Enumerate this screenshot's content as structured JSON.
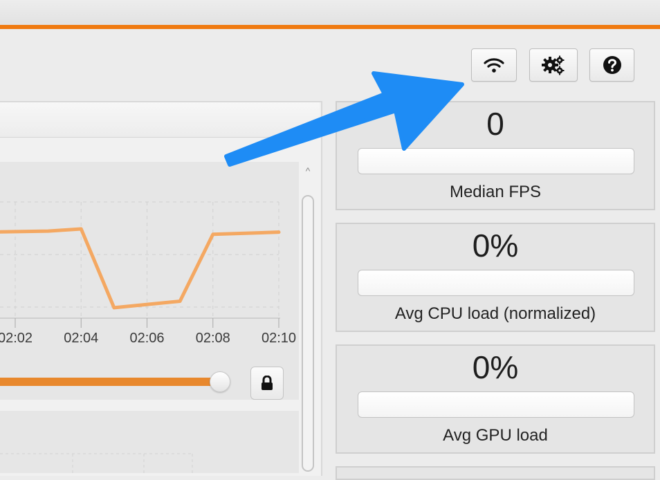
{
  "colors": {
    "accent": "#f07a10",
    "series": "#f4a862",
    "arrow": "#1e8cf5"
  },
  "toolbar": {
    "buttons": [
      {
        "icon": "wifi-icon"
      },
      {
        "icon": "gear-icon"
      },
      {
        "icon": "help-icon"
      }
    ]
  },
  "timeline": {
    "ticks": [
      "02:02",
      "02:04",
      "02:06",
      "02:08",
      "02:10"
    ],
    "series": [
      {
        "t": "02:01",
        "v": 0.72
      },
      {
        "t": "02:03",
        "v": 0.73
      },
      {
        "t": "02:04",
        "v": 0.75
      },
      {
        "t": "02:05",
        "v": 0.02
      },
      {
        "t": "02:07",
        "v": 0.08
      },
      {
        "t": "02:08",
        "v": 0.7
      },
      {
        "t": "02:10",
        "v": 0.72
      }
    ],
    "slider_position": 1.0,
    "lock_icon": "lock-icon"
  },
  "metrics": [
    {
      "value": "0",
      "label": "Median FPS",
      "fill": 0
    },
    {
      "value": "0%",
      "label": "Avg CPU load (normalized)",
      "fill": 0
    },
    {
      "value": "0%",
      "label": "Avg GPU load",
      "fill": 0
    }
  ]
}
